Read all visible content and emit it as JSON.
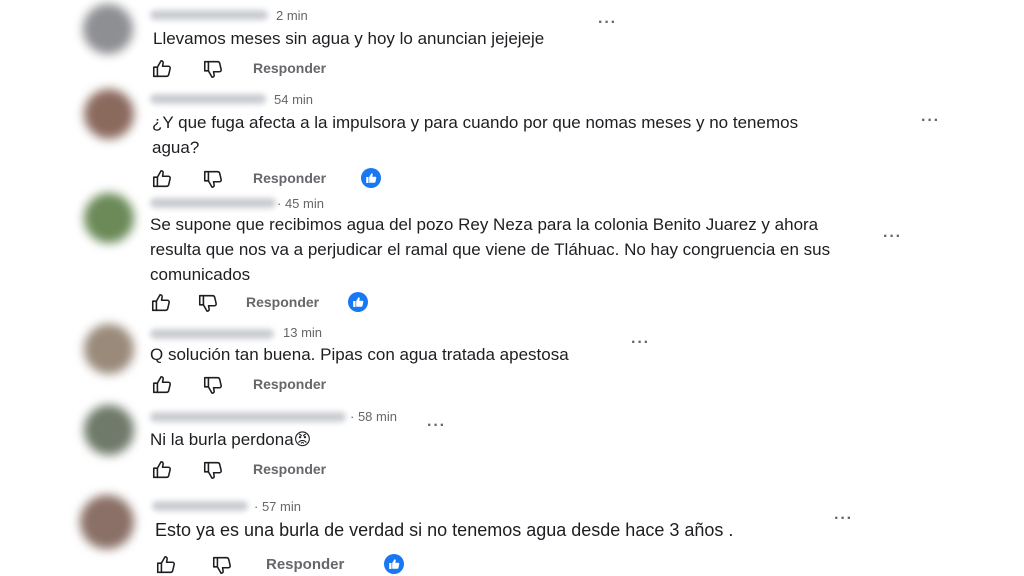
{
  "colors": {
    "text": "#1c1e21",
    "meta": "#65676b",
    "like_blue": "#1877f2"
  },
  "icons": {
    "like": "thumbs-up-icon",
    "dislike": "thumbs-down-icon",
    "more": "more-options-icon",
    "reaction": "like-reaction-badge-icon"
  },
  "comments": [
    {
      "time": "2 min",
      "text": "Llevamos meses sin agua y hoy lo anuncian jejejeje",
      "more_label": "···",
      "reply_label": "Responder",
      "has_reaction": false
    },
    {
      "time": "54 min",
      "text": "¿Y que fuga afecta a la impulsora y para cuando por que nomas meses y no tenemos\nagua?",
      "more_label": "···",
      "reply_label": "Responder",
      "has_reaction": true
    },
    {
      "time": "· 45 min",
      "text": "Se supone que recibimos agua del pozo Rey Neza para la colonia Benito Juarez y ahora\nresulta que nos va a perjudicar el ramal que viene de Tláhuac. No hay congruencia en sus\ncomunicados",
      "more_label": "···",
      "reply_label": "Responder",
      "has_reaction": true
    },
    {
      "time": "13 min",
      "text": "Q solución tan buena. Pipas con agua tratada apestosa",
      "more_label": "···",
      "reply_label": "Responder",
      "has_reaction": false
    },
    {
      "time": "· 58 min",
      "text": "Ni la burla perdona😡",
      "more_label": "···",
      "reply_label": "Responder",
      "has_reaction": false
    },
    {
      "time": "· 57 min",
      "text": "Esto ya es una burla de verdad si no tenemos agua desde hace 3 años .",
      "more_label": "···",
      "reply_label": "Responder",
      "has_reaction": true
    }
  ]
}
